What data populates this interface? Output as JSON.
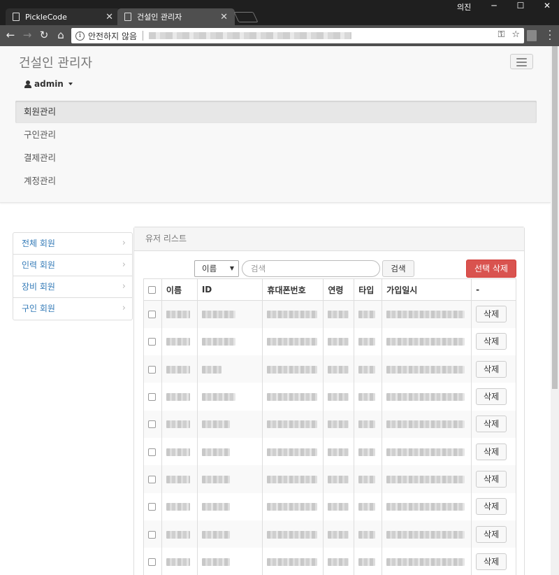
{
  "browser": {
    "tabs": [
      {
        "title": "PickleCode",
        "active": false
      },
      {
        "title": "건설인 관리자",
        "active": true
      }
    ],
    "window_user": "의진",
    "security_text": "안전하지 않음"
  },
  "header": {
    "brand": "건설인 관리자",
    "user": "admin",
    "menu": [
      "회원관리",
      "구인관리",
      "결제관리",
      "계정관리"
    ],
    "active_menu": "회원관리"
  },
  "sidebar": {
    "items": [
      {
        "label": "전체 회원"
      },
      {
        "label": "인력 회원"
      },
      {
        "label": "장비 회원"
      },
      {
        "label": "구인 회원"
      }
    ]
  },
  "panel": {
    "title": "유저 리스트",
    "search_field": "이름",
    "search_placeholder": "검색",
    "search_button": "검색",
    "delete_selected": "선택 삭제",
    "columns": [
      "이름",
      "ID",
      "휴대폰번호",
      "연령",
      "타입",
      "가입일시",
      "-"
    ],
    "row_delete_label": "삭제",
    "row_count": 10
  },
  "colors": {
    "danger": "#d9534f",
    "link": "#337ab7",
    "navbar_bg": "#f8f8f8"
  }
}
